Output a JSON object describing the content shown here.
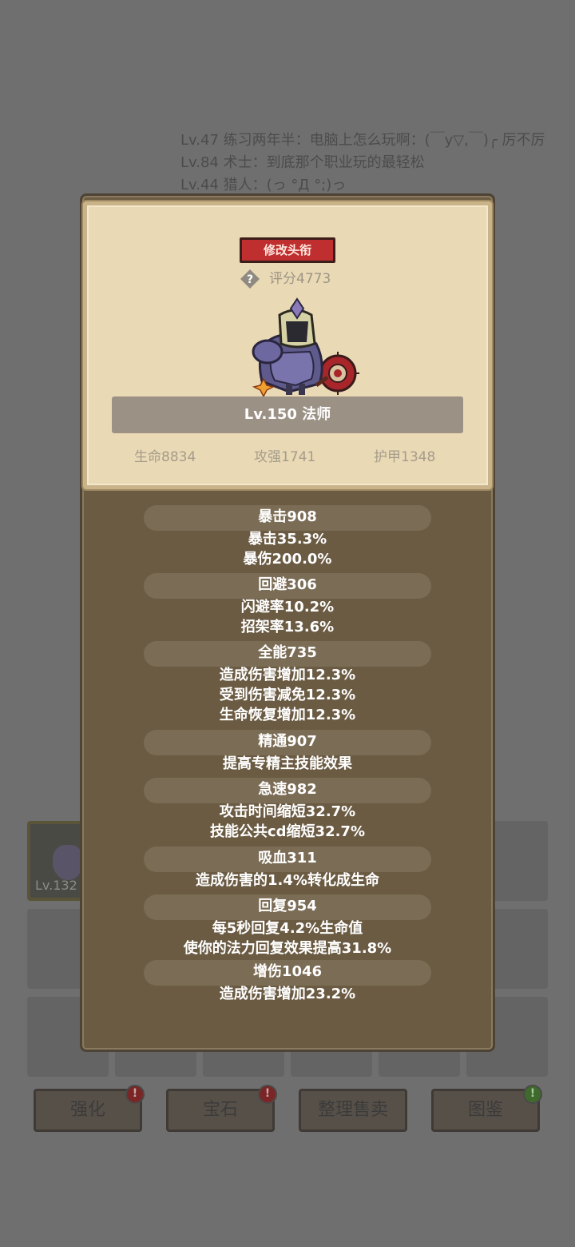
{
  "background": {
    "chat": [
      "Lv.47 练习两年半：电脑上怎么玩啊：(￣y▽,￣)╭ 厉不厉",
      "Lv.84 术士：到底那个职业玩的最轻松",
      "Lv.44 猎人：(っ °Д °;)っ"
    ],
    "item_slot_level": "Lv.132",
    "buttons": [
      {
        "label": "强化",
        "badge": "!"
      },
      {
        "label": "宝石",
        "badge": "!"
      },
      {
        "label": "整理售卖",
        "badge": ""
      },
      {
        "label": "图鉴",
        "badge": "!"
      }
    ]
  },
  "card": {
    "edit_title_label": "修改头衔",
    "help_icon": "?",
    "score_label": "评分4773",
    "character_name": "Lv.150 法师",
    "top_stats": [
      "生命8834",
      "攻强1741",
      "护甲1348"
    ]
  },
  "sections": [
    {
      "title": "暴击908",
      "details": [
        "暴击35.3%",
        "暴伤200.0%"
      ]
    },
    {
      "title": "回避306",
      "details": [
        "闪避率10.2%",
        "招架率13.6%"
      ]
    },
    {
      "title": "全能735",
      "details": [
        "造成伤害增加12.3%",
        "受到伤害减免12.3%",
        "生命恢复增加12.3%"
      ]
    },
    {
      "title": "精通907",
      "details": [
        "提高专精主技能效果"
      ]
    },
    {
      "title": "急速982",
      "details": [
        "攻击时间缩短32.7%",
        "技能公共cd缩短32.7%"
      ]
    },
    {
      "title": "吸血311",
      "details": [
        "造成伤害的1.4%转化成生命"
      ]
    },
    {
      "title": "回复954",
      "details": [
        "每5秒回复4.2%生命值",
        "使你的法力回复效果提高31.8%"
      ]
    },
    {
      "title": "增伤1046",
      "details": [
        "造成伤害增加23.2%"
      ]
    }
  ]
}
